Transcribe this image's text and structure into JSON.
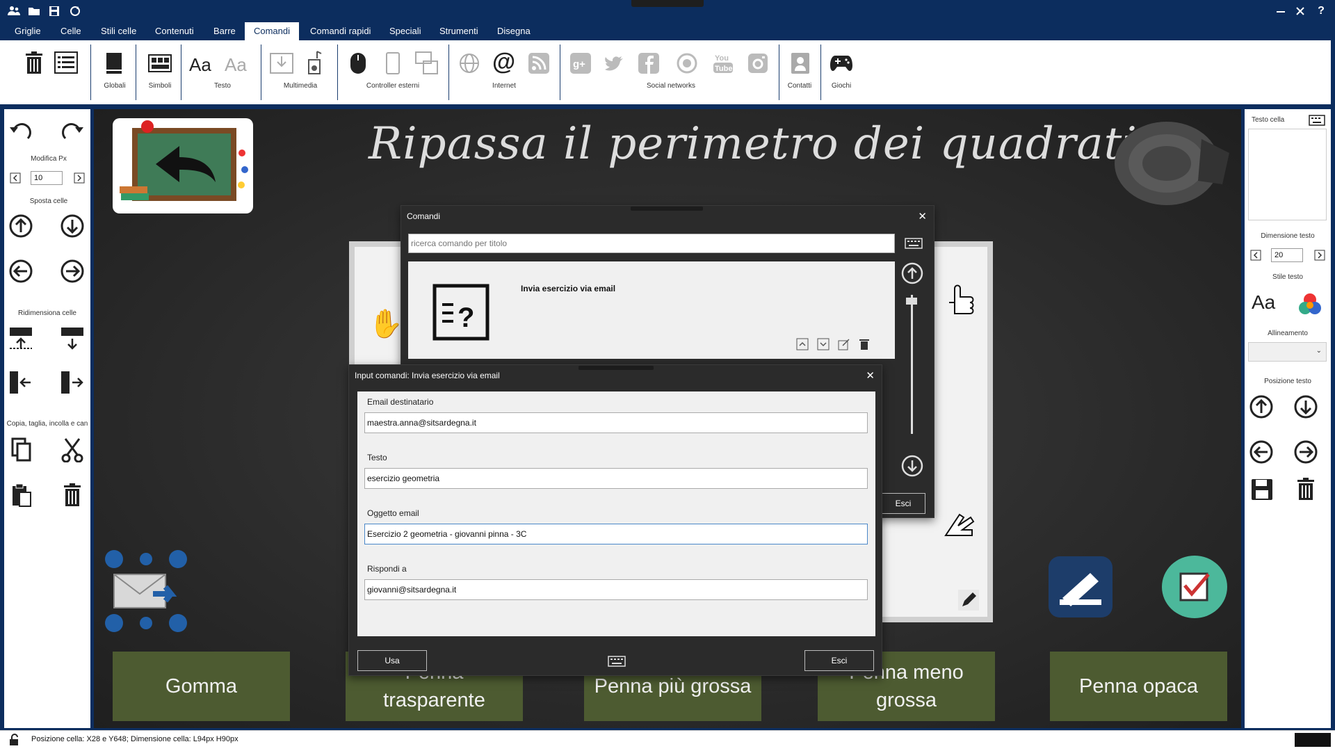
{
  "ribbon": {
    "tabs": [
      "Griglie",
      "Celle",
      "Stili celle",
      "Contenuti",
      "Barre",
      "Comandi",
      "Comandi rapidi",
      "Speciali",
      "Strumenti",
      "Disegna"
    ],
    "active_tab": "Comandi",
    "groups": {
      "globali": "Globali",
      "simboli": "Simboli",
      "testo": "Testo",
      "multimedia": "Multimedia",
      "controller": "Controller esterni",
      "internet": "Internet",
      "social": "Social networks",
      "contatti": "Contatti",
      "giochi": "Giochi"
    },
    "testo_icon_1": "Aa",
    "testo_icon_2": "Aa"
  },
  "left_panel": {
    "modifica_px_label": "Modifica Px",
    "modifica_px_value": "10",
    "sposta_celle_label": "Sposta celle",
    "ridimensiona_label": "Ridimensiona celle",
    "copia_label": "Copia, taglia, incolla e can"
  },
  "right_panel": {
    "testo_cella_label": "Testo cella",
    "dimensione_label": "Dimensione testo",
    "dimensione_value": "20",
    "stile_label": "Stile testo",
    "stile_icon": "Aa",
    "allineamento_label": "Allineamento",
    "posizione_label": "Posizione testo"
  },
  "canvas": {
    "heading": "Ripassa il perimetro dei quadrati!",
    "cells": [
      "Gomma",
      "Penna trasparente",
      "Penna più grossa",
      "Penna meno grossa",
      "Penna opaca"
    ]
  },
  "comandi_dialog": {
    "title": "Comandi",
    "search_placeholder": "ricerca comando per titolo",
    "item_title": "Invia esercizio via email",
    "esci_label": "Esci"
  },
  "input_dialog": {
    "title": "Input comandi: Invia esercizio via email",
    "fields": [
      {
        "label": "Email destinatario",
        "value": "maestra.anna@sitsardegna.it"
      },
      {
        "label": "Testo",
        "value": "esercizio geometria"
      },
      {
        "label": "Oggetto email",
        "value": "Esercizio 2 geometria - giovanni pinna - 3C"
      },
      {
        "label": "Rispondi a",
        "value": "giovanni@sitsardegna.it"
      }
    ],
    "usa_label": "Usa",
    "esci_label": "Esci"
  },
  "status": {
    "text": "Posizione cella: X28 e Y648; Dimensione cella: L94px H90px"
  }
}
